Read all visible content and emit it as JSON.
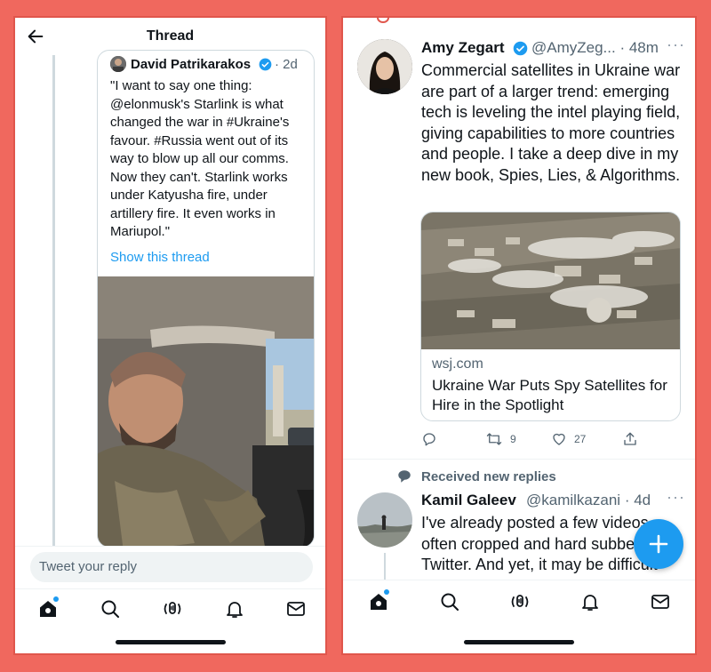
{
  "left_screen": {
    "header": {
      "title": "Thread",
      "back_icon": "arrow-left-icon"
    },
    "quoted_tweet": {
      "author_name": "David Patrikarakos",
      "verified_icon": "verified-badge-icon",
      "time": "· 2d",
      "text": "\"I want to say one thing: @elonmusk's Starlink is what changed the war in #Ukraine's favour. #Russia went out of its way to blow up all our comms. Now they can't. Starlink works under Katyusha fire, under artillery fire. It even works in Mariupol.\"",
      "show_thread": "Show this thread",
      "photo": "man-in-car-photo"
    },
    "reply": {
      "placeholder": "Tweet your reply"
    },
    "tabbar": [
      "home-icon",
      "search-icon",
      "spaces-icon",
      "notifications-icon",
      "messages-icon"
    ]
  },
  "right_screen": {
    "tweet": {
      "author_name": "Amy Zegart",
      "handle": "@AmyZeg...",
      "time": "· 48m",
      "more": "···",
      "text": "Commercial satellites in Ukraine war are part of a larger trend: emerging tech is leveling the intel playing field, giving capabilities to more countries and people. I take a deep dive in my new book, Spies, Lies, & Algorithms.",
      "link_card": {
        "domain": "wsj.com",
        "title": "Ukraine War Puts Spy Satellites for Hire in the Spotlight",
        "image": "satellite-image"
      },
      "actions": {
        "replies": "",
        "retweets": "9",
        "likes": "27"
      }
    },
    "received_label": "Received new replies",
    "next_tweet": {
      "author_name": "Kamil Galeev",
      "handle": "@kamilkazani",
      "time": "· 4d",
      "more": "···",
      "text": "I've already posted a few videos often cropped and hard subbed Twitter. And yet, it may be difficult"
    },
    "fab": "compose-plus-icon",
    "tabbar": [
      "home-icon",
      "search-icon",
      "spaces-icon",
      "notifications-icon",
      "messages-icon"
    ]
  },
  "colors": {
    "accent": "#1d9bf0",
    "frame": "#f0685e",
    "text": "#0f1419",
    "muted": "#536471"
  }
}
